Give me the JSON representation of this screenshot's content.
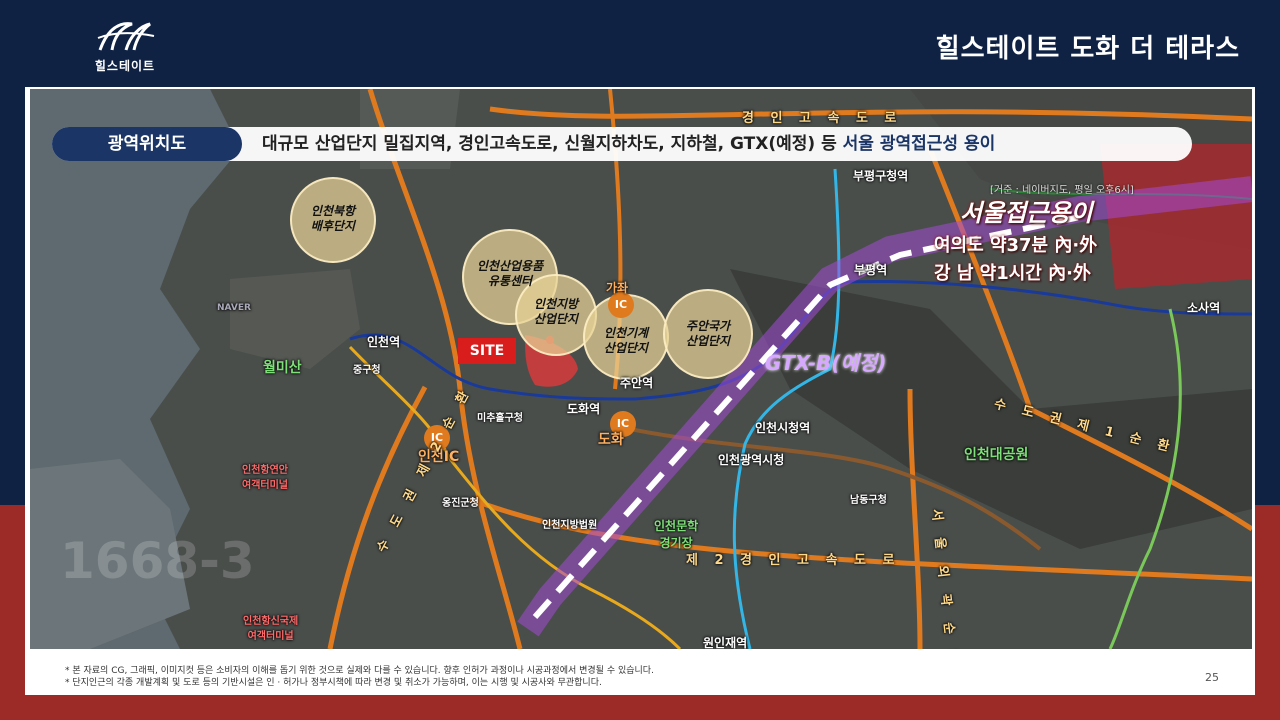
{
  "header": {
    "logo_text": "힐스테이트",
    "title": "힐스테이트 도화 더 테라스"
  },
  "tag": {
    "pill": "광역위치도",
    "desc": "대규모 산업단지 밀집지역, 경인고속도로, 신월지하차도, 지하철, GTX(예정) 등",
    "highlight": "서울 광역접근성 용이"
  },
  "map": {
    "roads": {
      "gyeongin": "경 인 고 속 도 로",
      "gyeongin2": "제 2  경 인 고 속 도 로",
      "metro1": "수 도 권 제 1 순 환",
      "metro2": "수 도 권 제 2 순 환",
      "seoul_ring": "서 울 외 곽 순 환"
    },
    "stations": {
      "bupyeong_gu": "부평구청역",
      "bupyeong": "부평역",
      "sosa": "소사역",
      "incheon": "인천역",
      "juan": "주안역",
      "dohwa": "도화역",
      "city_hall": "인천시청역",
      "metro_city_hall": "인천광역시청",
      "wonin": "원인재역"
    },
    "places": {
      "gajwa": "가좌",
      "jung_gu": "중구청",
      "wolmi": "월미산",
      "michuhol": "미추홀구청",
      "ongjin": "옹진군청",
      "court": "인천지방법원",
      "namdong": "남동구청",
      "grand_park": "인천대공원",
      "stadium": "인천문학\n경기장",
      "ferry1": "인천항연안\n여객터미널",
      "ferry2": "인천항신국제\n여객터미널",
      "navi": "NAVER"
    },
    "ic": {
      "gajwa": "IC",
      "incheon": "IC",
      "dohwa": "IC",
      "incheon_label": "인천IC",
      "dohwa_label": "도화"
    },
    "bubbles": {
      "b1": "인천북항\n배후단지",
      "b2": "인천산업용품\n유통센터",
      "b3": "인천지방\n산업단지",
      "b4": "인천기계\n산업단지",
      "b5": "주안국가\n산업단지"
    },
    "site": "SITE",
    "source": "[거준 : 네이버지도, 평일 오후6시]",
    "seoul": {
      "title": "서울접근용이",
      "line1": "여의도 약37분 內·外",
      "line2": "강  남 약1시간 內·外"
    },
    "gtx": "GTX-B(예정)",
    "watermark": "1668-3"
  },
  "footer": {
    "note1": "* 본 자료의 CG, 그래픽, 이미지컷 등은 소비자의 이해를 돕기 위한 것으로 실제와 다를 수 있습니다. 향후 인허가 과정이나 시공과정에서 변경될 수 있습니다.",
    "note2": "* 단지인근의 각종 개발계획 및 도로 등의 기반시설은 인 · 허가나 정부시책에 따라 변경 및 취소가 가능하며, 이는 시행 및 시공사와 무관합니다.",
    "page": "25"
  },
  "colors": {
    "navy": "#0f2244",
    "red": "#9c2a26",
    "road": "#e07a1e",
    "metro1": "#1a3a9a",
    "gtx": "#a24ad6"
  }
}
